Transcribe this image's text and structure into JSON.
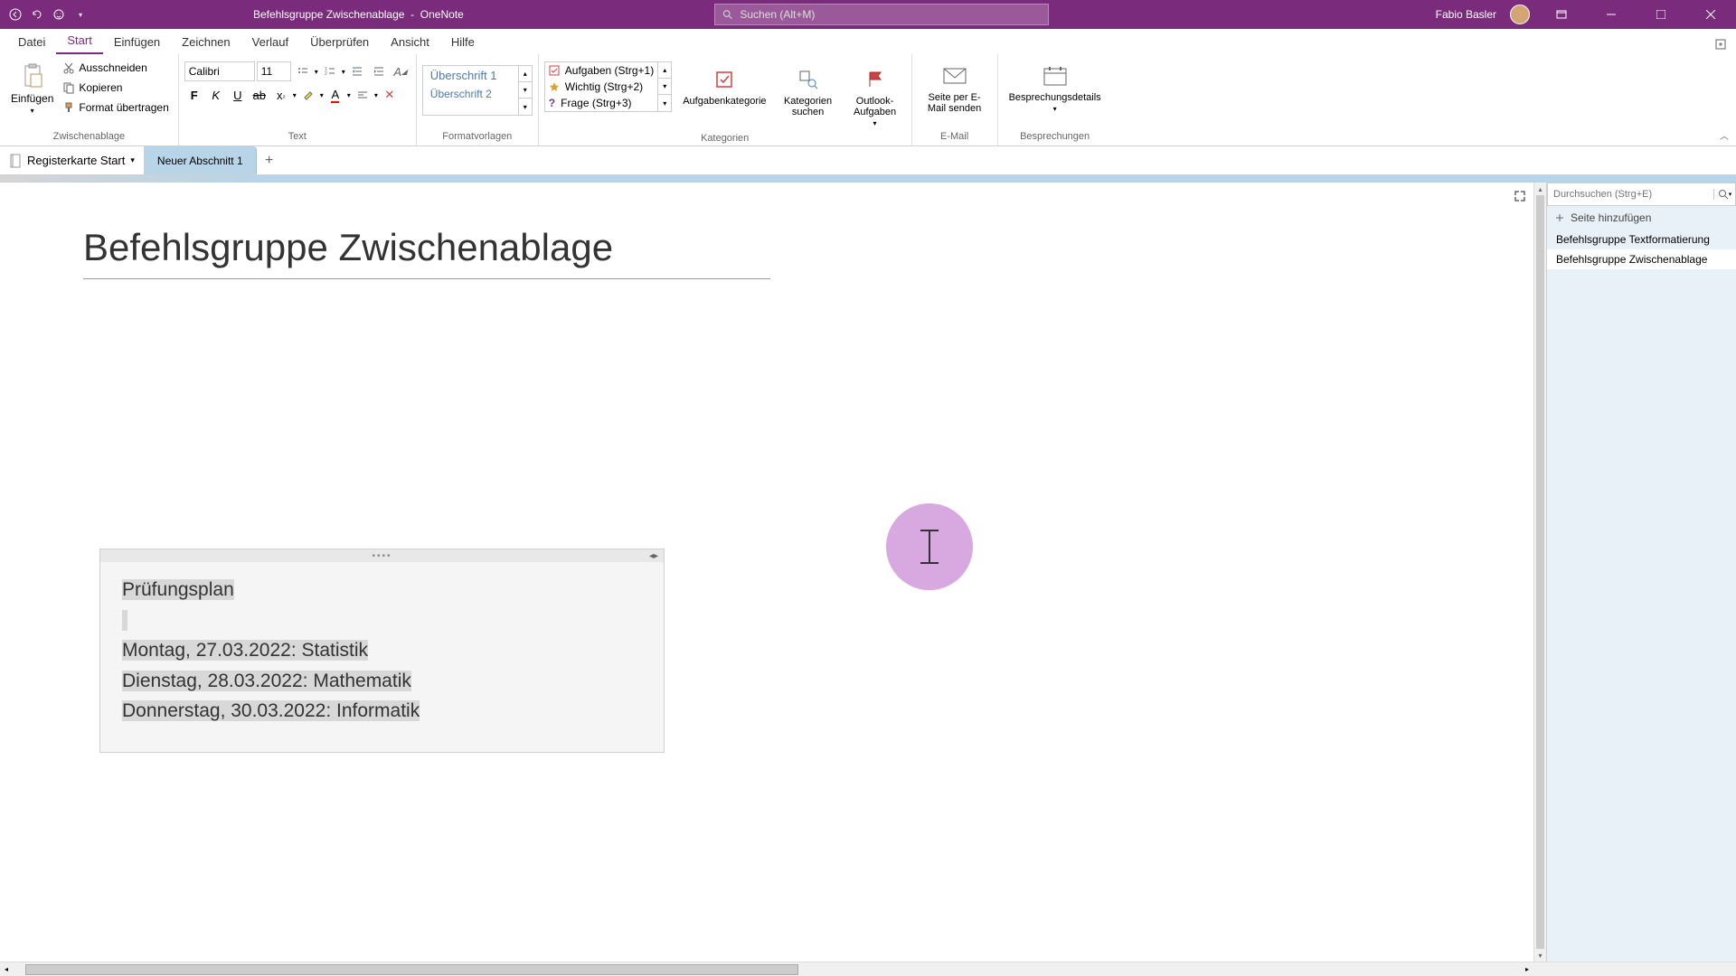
{
  "titlebar": {
    "doc_title": "Befehlsgruppe Zwischenablage",
    "app_name": "OneNote",
    "search_placeholder": "Suchen (Alt+M)",
    "user_name": "Fabio Basler"
  },
  "menu": {
    "datei": "Datei",
    "start": "Start",
    "einfuegen": "Einfügen",
    "zeichnen": "Zeichnen",
    "verlauf": "Verlauf",
    "ueberpruefen": "Überprüfen",
    "ansicht": "Ansicht",
    "hilfe": "Hilfe"
  },
  "ribbon": {
    "clipboard": {
      "einfuegen": "Einfügen",
      "ausschneiden": "Ausschneiden",
      "kopieren": "Kopieren",
      "format": "Format übertragen",
      "label": "Zwischenablage"
    },
    "font": {
      "name": "Calibri",
      "size": "11",
      "label": "Text"
    },
    "styles": {
      "h1": "Überschrift 1",
      "h2": "Überschrift 2",
      "label": "Formatvorlagen"
    },
    "tags": {
      "aufgaben": "Aufgaben (Strg+1)",
      "wichtig": "Wichtig (Strg+2)",
      "frage": "Frage (Strg+3)",
      "aufgabenkategorie": "Aufgabenkategorie",
      "kategorien": "Kategorien suchen",
      "outlook": "Outlook-Aufgaben",
      "label": "Kategorien"
    },
    "email": {
      "send": "Seite per E-Mail senden",
      "label": "E-Mail"
    },
    "meetings": {
      "details": "Besprechungsdetails",
      "label": "Besprechungen"
    }
  },
  "notebook": {
    "selector": "Registerkarte Start",
    "section": "Neuer Abschnitt 1"
  },
  "page": {
    "title": "Befehlsgruppe Zwischenablage",
    "note": {
      "heading": "Prüfungsplan",
      "line1": "Montag, 27.03.2022: Statistik",
      "line2": "Dienstag, 28.03.2022: Mathematik",
      "line3": "Donnerstag, 30.03.2022: Informatik"
    }
  },
  "rightpanel": {
    "search_placeholder": "Durchsuchen (Strg+E)",
    "add_page": "Seite hinzufügen",
    "pages": {
      "p1": "Befehlsgruppe Textformatierung",
      "p2": "Befehlsgruppe Zwischenablage"
    }
  }
}
